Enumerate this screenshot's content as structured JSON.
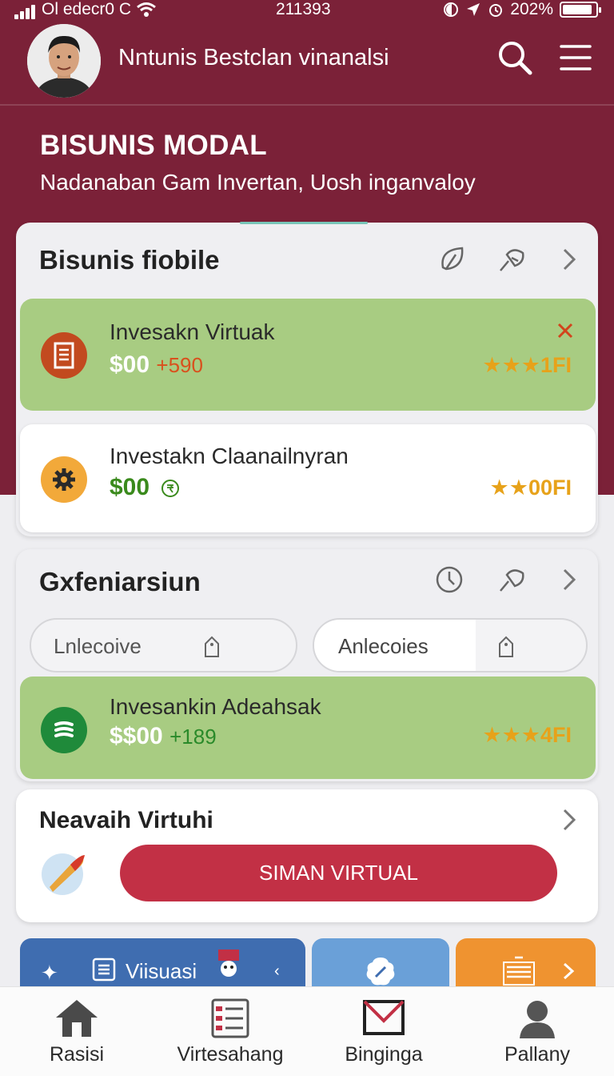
{
  "status_bar": {
    "carrier": "Ol edecr0 C",
    "time": "211393",
    "battery": "202%"
  },
  "header": {
    "title": "Nntunis Bestclan vinanalsi"
  },
  "hero": {
    "title": "BISUNIS MODAL",
    "subtitle": "Nadanaban Gam Invertan, Uosh inganvaloy"
  },
  "card1": {
    "title": "Bisunis fiobile",
    "rows": [
      {
        "title": "Invesakn Virtuak",
        "amount": "$00",
        "change": "+590",
        "rating": "1FI"
      },
      {
        "title": "Investakn Claanailnyran",
        "amount": "$00",
        "change": "",
        "rating": "00FI"
      }
    ]
  },
  "card2": {
    "title": "Gxfeniarsiun",
    "tabs": [
      {
        "label": "Lnlecoive"
      },
      {
        "label": "Anlecoies"
      }
    ],
    "rows": [
      {
        "title": "Invesankin Adeahsak",
        "amount": "$$00",
        "change": "+189",
        "rating": "4FI"
      }
    ]
  },
  "card3": {
    "title": "Neavaih Virtuhi",
    "button_label": "SIMAN VIRTUAL"
  },
  "tiles": [
    {
      "label": "Viisuasi"
    }
  ],
  "bottom_nav": [
    {
      "label": "Rasisi"
    },
    {
      "label": "Virtesahang"
    },
    {
      "label": "Binginga"
    },
    {
      "label": "Pallany"
    }
  ],
  "colors": {
    "brand": "#7b2138",
    "positive_row": "#a8cc82",
    "cta": "#c23045",
    "rating": "#e7a21a"
  }
}
